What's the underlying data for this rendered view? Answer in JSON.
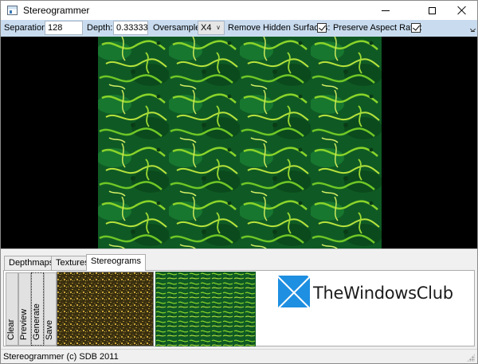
{
  "window": {
    "title": "Stereogrammer",
    "controls": {
      "minimize": "minimize-icon",
      "maximize": "maximize-icon",
      "close": "close-icon"
    }
  },
  "toolbar": {
    "separation_label": "Separation:",
    "separation_value": "128",
    "depth_label": "Depth:",
    "depth_value": "0.33333",
    "oversample_label": "Oversample:",
    "oversample_value": "X4",
    "remove_hidden_label": "Remove Hidden Surfaces:",
    "remove_hidden_checked": true,
    "preserve_aspect_label": "Preserve Aspect Ratio:",
    "preserve_aspect_checked": true
  },
  "tabs": [
    {
      "label": "Depthmaps",
      "active": false
    },
    {
      "label": "Textures",
      "active": false
    },
    {
      "label": "Stereograms",
      "active": true
    }
  ],
  "actions": {
    "clear": "Clear",
    "preview": "Preview",
    "generate": "Generate",
    "save": "Save"
  },
  "watermark": {
    "text": "TheWindowsClub"
  },
  "status": {
    "text": "Stereogrammer (c) SDB 2011"
  },
  "colors": {
    "toolbar_bg": "#c9dcef",
    "viewer_bg": "#000000",
    "texture_dark_green": "#0b4a1c",
    "texture_light_green": "#7ed321",
    "brand_blue": "#1e8fe1"
  }
}
